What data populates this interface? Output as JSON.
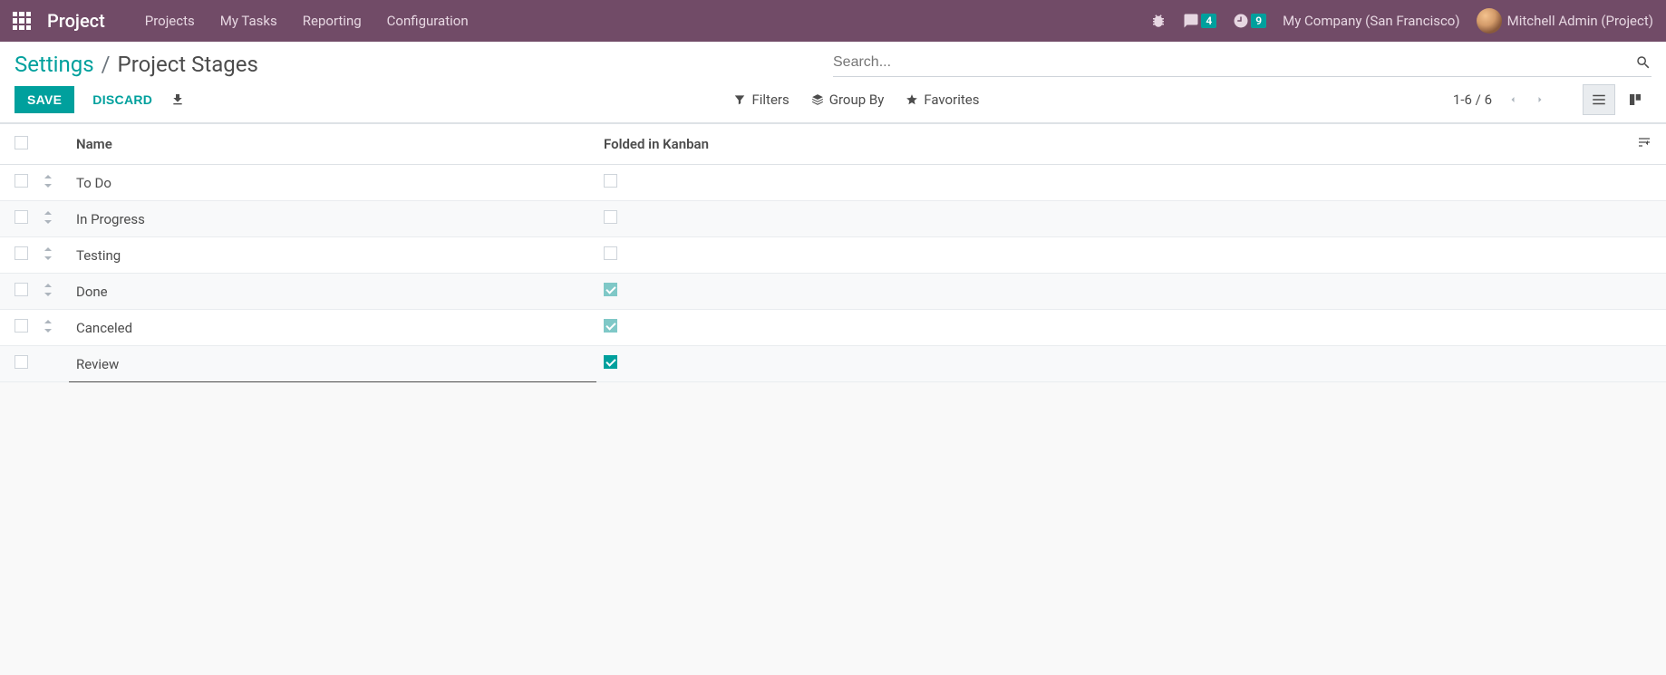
{
  "topnav": {
    "brand": "Project",
    "links": [
      "Projects",
      "My Tasks",
      "Reporting",
      "Configuration"
    ],
    "discuss_badge": "4",
    "activity_badge": "9",
    "company": "My Company (San Francisco)",
    "user": "Mitchell Admin (Project)"
  },
  "breadcrumb": {
    "parent": "Settings",
    "current": "Project Stages"
  },
  "buttons": {
    "save": "SAVE",
    "discard": "DISCARD"
  },
  "search": {
    "placeholder": "Search...",
    "filters": "Filters",
    "group_by": "Group By",
    "favorites": "Favorites"
  },
  "pager": {
    "range": "1-6",
    "total": "6"
  },
  "table": {
    "columns": {
      "name": "Name",
      "folded": "Folded in Kanban"
    },
    "rows": [
      {
        "name": "To Do",
        "folded": false,
        "draggable": true,
        "editing": false
      },
      {
        "name": "In Progress",
        "folded": false,
        "draggable": true,
        "editing": false
      },
      {
        "name": "Testing",
        "folded": false,
        "draggable": true,
        "editing": false
      },
      {
        "name": "Done",
        "folded": true,
        "draggable": true,
        "editing": false,
        "folded_readonly": true
      },
      {
        "name": "Canceled",
        "folded": true,
        "draggable": true,
        "editing": false,
        "folded_readonly": true
      },
      {
        "name": "Review",
        "folded": true,
        "draggable": false,
        "editing": true
      }
    ]
  }
}
